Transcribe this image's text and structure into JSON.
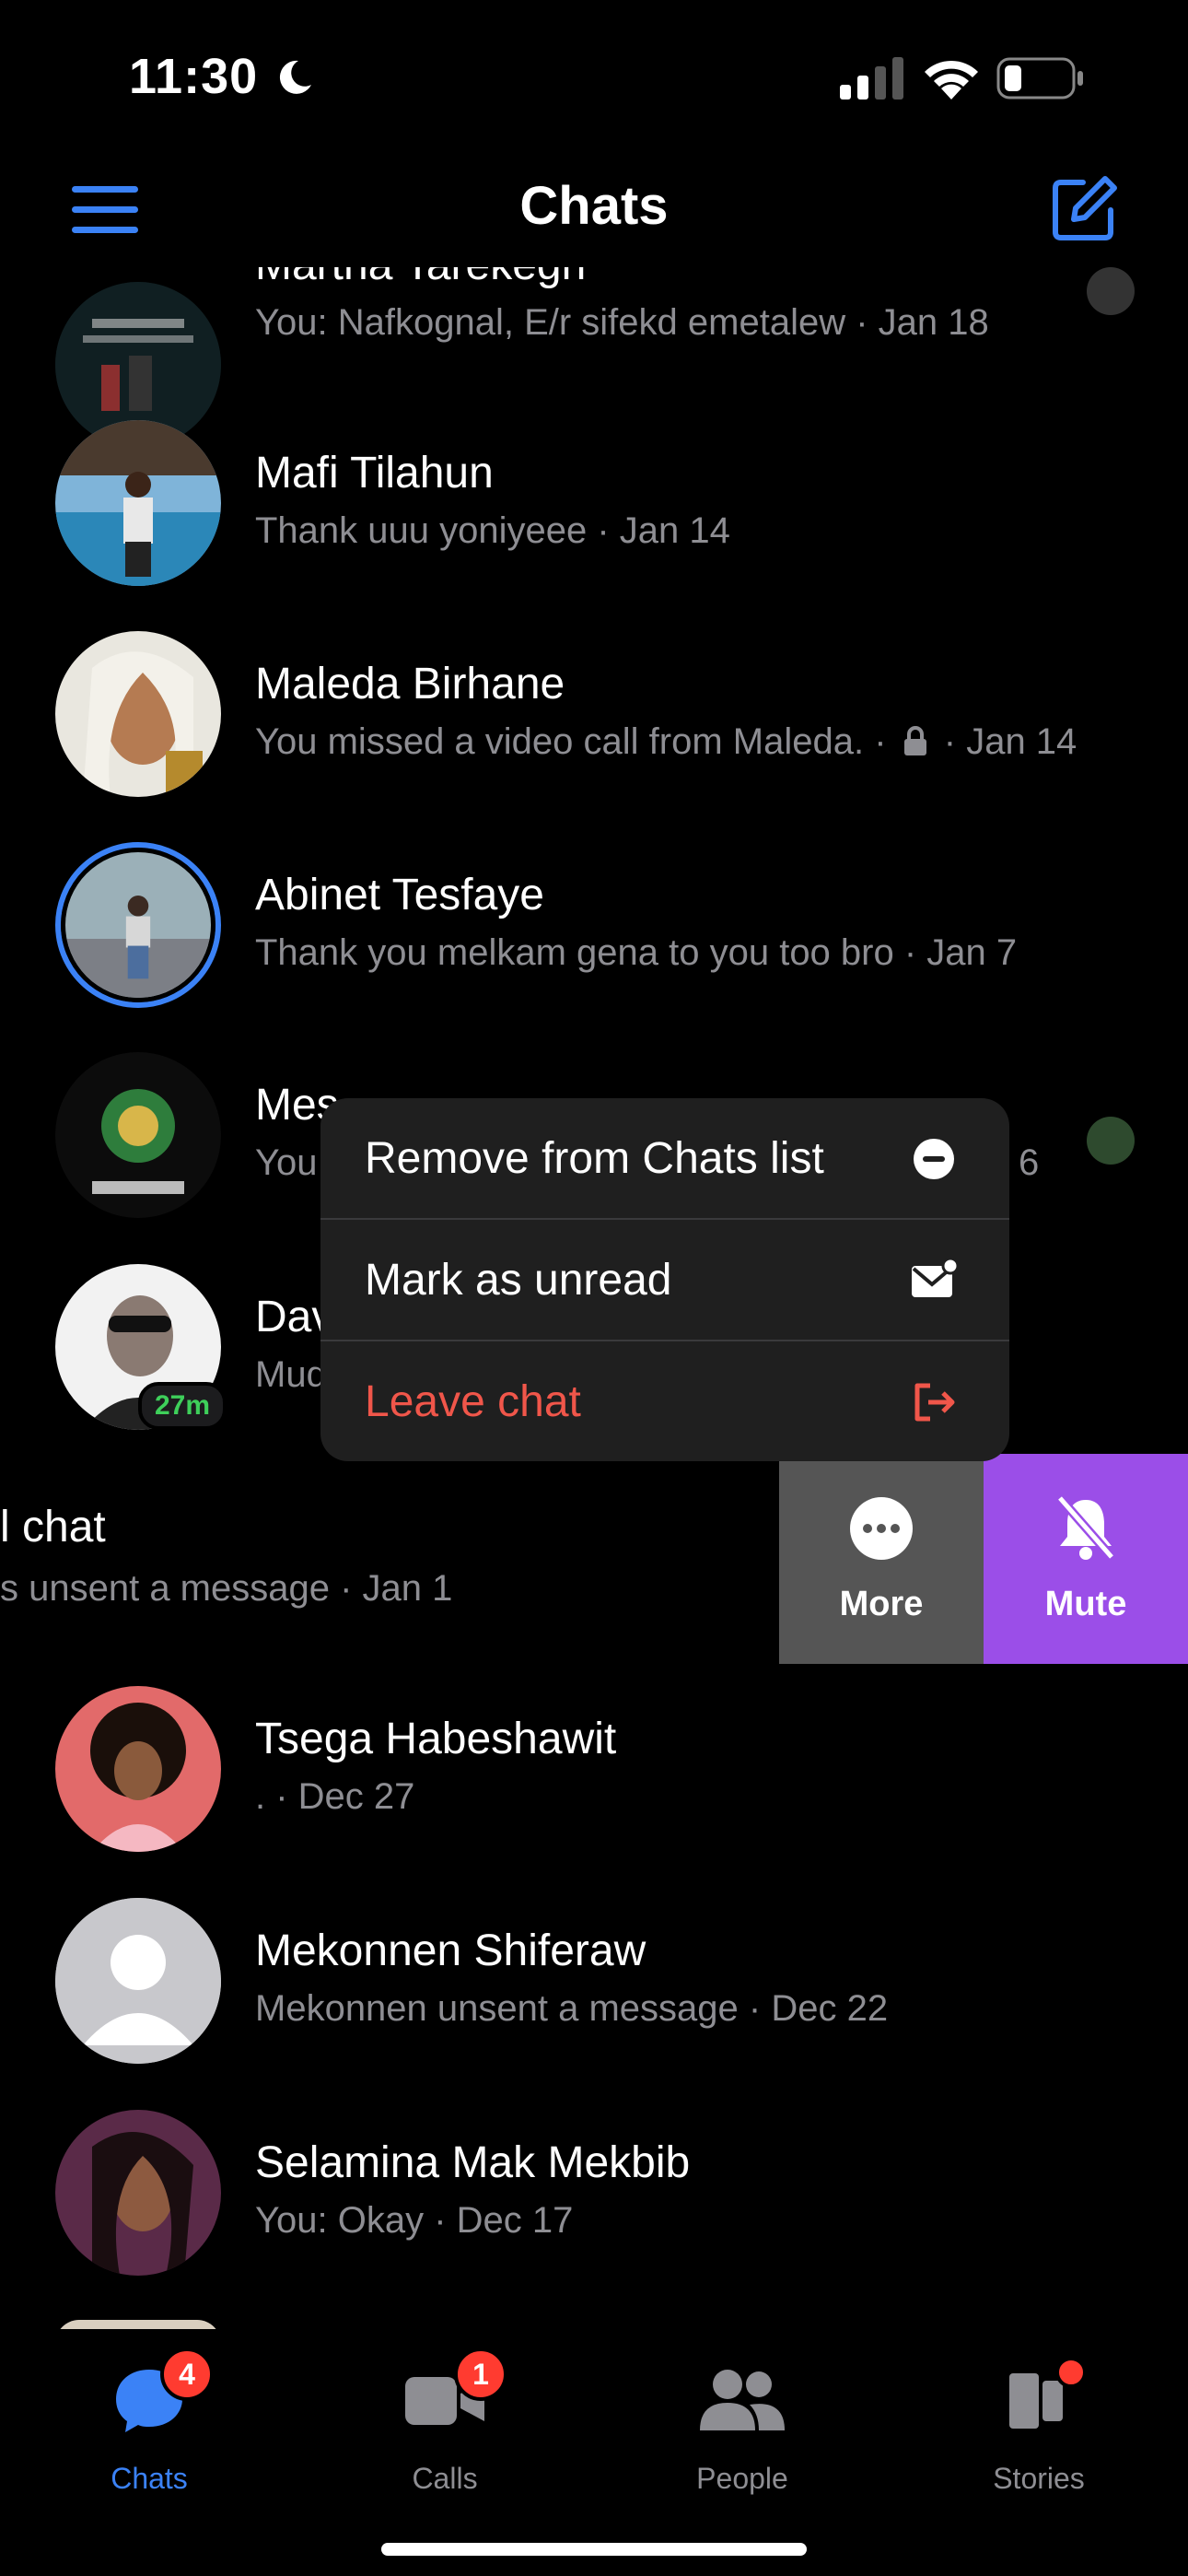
{
  "status_bar": {
    "time": "11:30"
  },
  "header": {
    "title": "Chats"
  },
  "chats": [
    {
      "name": "Martha Tarekegn",
      "preview": "You: Nafkognal, E/r sifekd emetalew · Jan 18"
    },
    {
      "name": "Mafi Tilahun",
      "preview": "Thank uuu yoniyeee · Jan 14"
    },
    {
      "name": "Maleda Birhane",
      "preview_before_lock": "You missed a video call from Maleda. ·",
      "preview_after_lock": "· Jan 14"
    },
    {
      "name": "Abinet Tesfaye",
      "preview": "Thank you melkam gena to you too bro · Jan 7"
    },
    {
      "name": "Mesfin A",
      "name_visible": "Mes",
      "preview_visible": "You",
      "date_fragment": "6"
    },
    {
      "name_visible": "Dav",
      "preview_visible": "Mud",
      "active_badge": "27m"
    },
    {
      "name_visible": "l chat",
      "preview_visible": "s unsent a message · Jan 1"
    },
    {
      "name": "Tsega Habeshawit",
      "preview": ". · Dec 27"
    },
    {
      "name": "Mekonnen Shiferaw",
      "preview": "Mekonnen unsent a message · Dec 22"
    },
    {
      "name": "Selamina Mak Mekbib",
      "preview": "You: Okay · Dec 17"
    }
  ],
  "swipe_actions": {
    "more_label": "More",
    "mute_label": "Mute",
    "more_color": "#555555",
    "mute_color": "#9b4ee8"
  },
  "context_menu": {
    "items": [
      {
        "label": "Remove from Chats list",
        "icon": "minus-circle-icon",
        "color": "#ffffff"
      },
      {
        "label": "Mark as unread",
        "icon": "envelope-unread-icon",
        "color": "#ffffff"
      },
      {
        "label": "Leave chat",
        "icon": "leave-icon",
        "color": "#f0564a"
      }
    ]
  },
  "tabbar": {
    "tabs": [
      {
        "label": "Chats",
        "badge": "4",
        "active": true
      },
      {
        "label": "Calls",
        "badge": "1"
      },
      {
        "label": "People"
      },
      {
        "label": "Stories",
        "dot": true
      }
    ]
  },
  "colors": {
    "accent": "#3b82f6",
    "badge": "#ff3b30",
    "destructive": "#f0564a",
    "secondary_text": "#8e8e93"
  }
}
